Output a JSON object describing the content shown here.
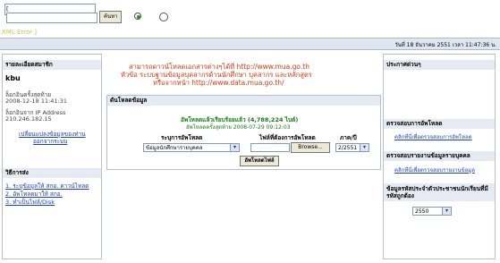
{
  "top": {
    "text_box_value": "[",
    "search_value": "",
    "search_button": "ค้นหา",
    "xml_error": "XML Error ]"
  },
  "datebar": {
    "text": "วันที่ 18 ธันวาคม 2551   เวลา 11:47:36 น."
  },
  "left": {
    "login_header": "รายละเอียดสมาชิก",
    "username": "kbu",
    "last_login_label": "ล็อกอินครั้งสุดท้าย",
    "last_login_value": "2008-12-18 11:41:31",
    "ip_label": "ล็อกอินจาก IP Address",
    "ip_value": "210.246.182.15",
    "change_info_link_1": "เปลี่ยนแปลงข้อมูลของท่าน",
    "change_info_link_2": "ออกจากระบบ",
    "howto_header": "วิธีการส่ง",
    "howto_items": [
      "1. ระบุข้อมูลให้ สกอ. ดาวน์โหลด",
      "2. อัพโหลดมาให้ สกอ.",
      "3. ทำเป็นไฟล์/Disk"
    ]
  },
  "center": {
    "notice_line1": "สามารถดาวน์โหลดเอกสารต่างๆได้ที่ http://www.mua.go.th",
    "notice_line2": "หัวข้อ ระบบฐานข้อมูลบุคลากรด้านนักศึกษา บุคลากร และหลักสูตร",
    "notice_line3": "หรือจากหน้า http://www.data.mua.go.th/",
    "download_header": "ดันโหลดข้อมูล",
    "upload_status": "อัพโหลดแล้วเรียบร้อยแล้ว (4,788,224 ไบต์)",
    "upload_last": "อัพโหลดครั้งสุดท้าย 2008-07-29 09:12:03",
    "col_system": "ระบุการอัพโหลด",
    "col_file": "ไฟล์ที่ต้องการอัพโหลด",
    "col_term": "ภาค/ปี",
    "system_value": "ข้อมูลนักศึกษารายบุคคล",
    "browse_label": "Browse...",
    "term_value": "2/2551",
    "upload_button": "อัพโหลดไฟล์"
  },
  "right": {
    "news_header": "ประกาศด่วนๆ",
    "check_upload_header": "ตรวจสอบการอัพโหลด",
    "check_upload_link": "คลิกที่นี่เพื่อตรวจสอบการอัพโหลด",
    "check_report_header": "ตรวจสอบรายงานข้อมูลรายบุคคล",
    "check_report_link": "คลิกที่นี่เพื่อตรวจสอบรายงานข้อมูล",
    "id_header": "ข้อมูลรหัสประจำตัวประชาชนนักเรียนที่มีรหัสถูกต้อง",
    "year_value": "2550"
  }
}
